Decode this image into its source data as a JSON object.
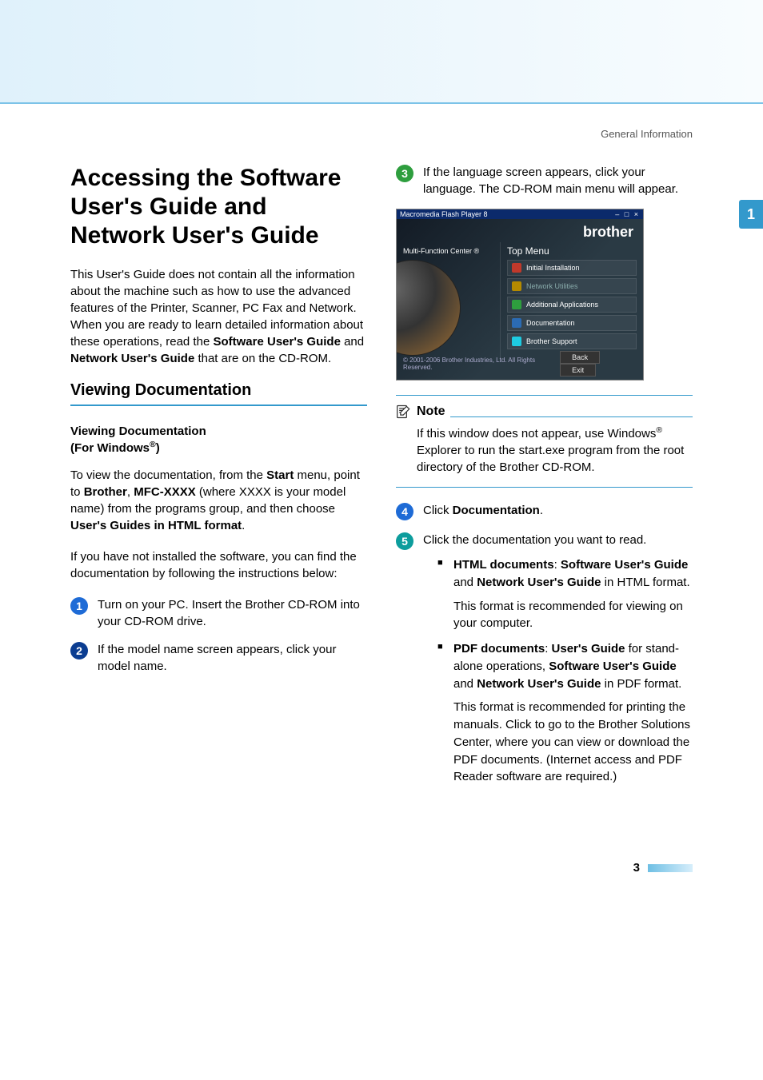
{
  "general_information": "General Information",
  "side_tab": "1",
  "h1": "Accessing the Software User's Guide and Network User's Guide",
  "intro": "This User's Guide does not contain all the information about the machine such as how to use the advanced features of the Printer, Scanner, PC Fax and Network. When you are ready to learn detailed information about these operations, read the ",
  "intro_bold1": "Software User's Guide",
  "intro_mid": " and ",
  "intro_bold2": "Network User's Guide",
  "intro_end": " that are on the CD-ROM.",
  "h2": "Viewing Documentation",
  "h3_pre": "Viewing Documentation",
  "h3_line2a": "(For Windows",
  "h3_line2b": ")",
  "para2_a": "To view the documentation, from the ",
  "para2_start": "Start",
  "para2_b": " menu, point to ",
  "para2_brother": "Brother",
  "para2_c": ", ",
  "para2_mfc": "MFC-XXXX",
  "para2_d": " (where XXXX is your model name) from the programs group, and then choose ",
  "para2_guides": "User's Guides in HTML format",
  "para2_e": ".",
  "para3": "If you have not installed the software, you can find the documentation by following the instructions below:",
  "step1": "Turn on your PC. Insert the Brother CD-ROM into your CD-ROM drive.",
  "step2": "If the model name screen appears, click your model name.",
  "step3": "If the language screen appears, click your language. The CD-ROM main menu will appear.",
  "screenshot": {
    "titlebar": "Macromedia Flash Player 8",
    "brand": "brother",
    "left_label": "Multi-Function Center ®",
    "top_menu": "Top Menu",
    "items": [
      "Initial Installation",
      "Network Utilities",
      "Additional Applications",
      "Documentation",
      "Brother Support"
    ],
    "copyright": "© 2001-2006 Brother Industries, Ltd. All Rights Reserved.",
    "back": "Back",
    "exit": "Exit"
  },
  "note_title": "Note",
  "note_a": "If this window does not appear, use Windows",
  "note_b": " Explorer to run the start.exe program from the root directory of the Brother CD-ROM.",
  "step4_a": "Click ",
  "step4_bold": "Documentation",
  "step4_b": ".",
  "step5": "Click the documentation you want to read.",
  "bullets": {
    "b1_strong1": "HTML documents",
    "b1_mid1": ": ",
    "b1_strong2": "Software User's Guide",
    "b1_mid2": " and ",
    "b1_strong3": "Network User's Guide",
    "b1_end": " in HTML format.",
    "b1_desc": "This format is recommended for viewing on your computer.",
    "b2_strong1": "PDF documents",
    "b2_mid1": ": ",
    "b2_strong2": "User's Guide",
    "b2_mid2": " for stand-alone operations, ",
    "b2_strong3": "Software User's Guide",
    "b2_mid3": " and ",
    "b2_strong4": "Network User's Guide",
    "b2_end": " in PDF format.",
    "b2_desc": "This format is recommended for printing the manuals. Click to go to the Brother Solutions Center, where you can view or download the PDF documents. (Internet access and PDF Reader software are required.)"
  },
  "page_number": "3",
  "labels": {
    "n1": "1",
    "n2": "2",
    "n3": "3",
    "n4": "4",
    "n5": "5"
  }
}
